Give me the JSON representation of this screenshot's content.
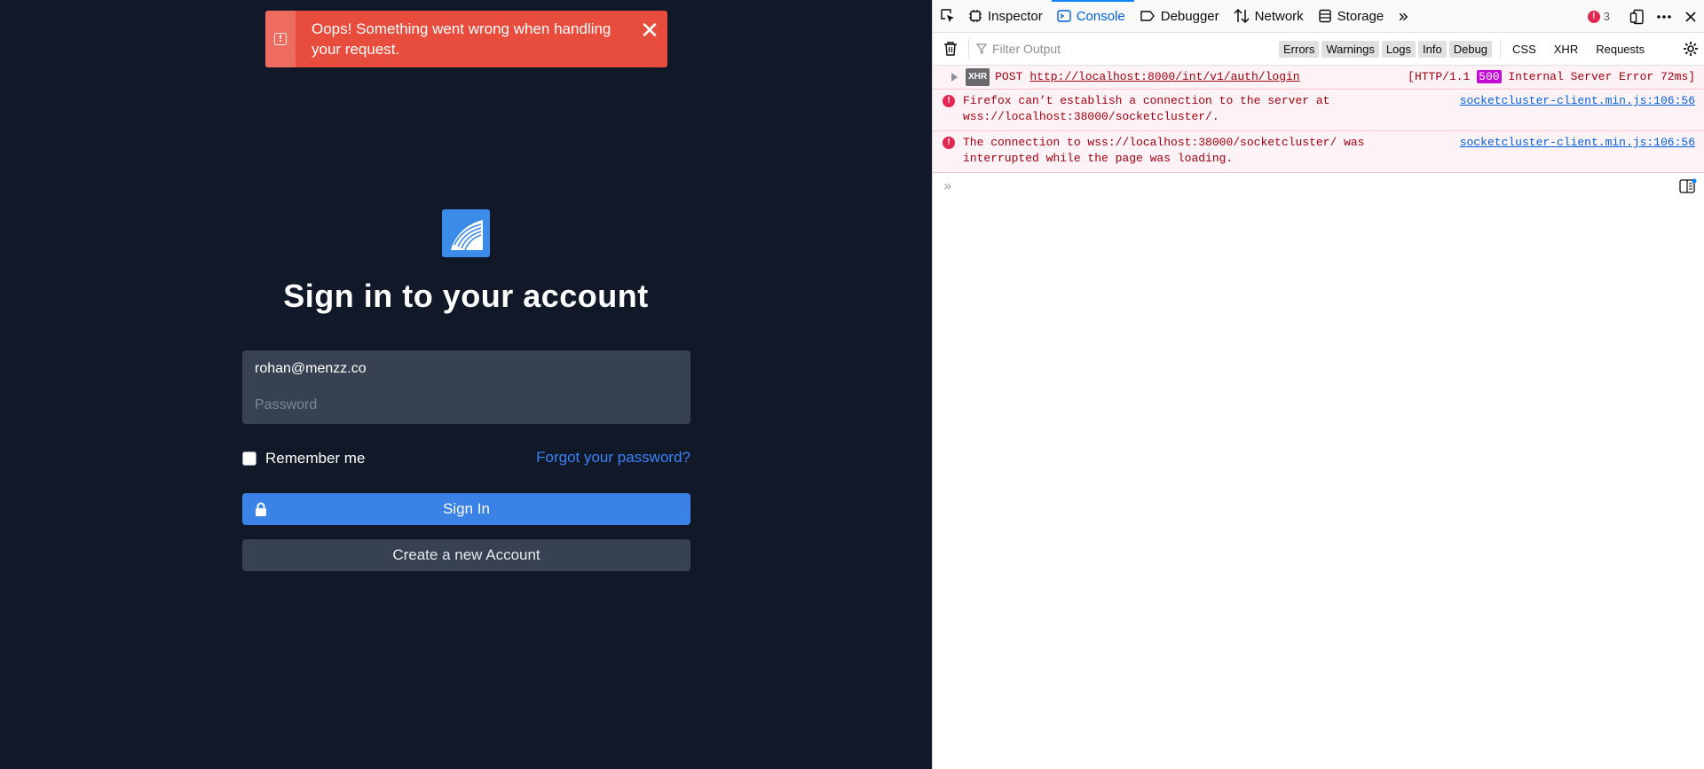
{
  "toast": {
    "message": "Oops! Something went wrong when handling your request.",
    "close_glyph": "✕",
    "icon_glyph": "!"
  },
  "login": {
    "title": "Sign in to your account",
    "email_value": "rohan@menzz.co",
    "password_placeholder": "Password",
    "remember_label": "Remember me",
    "forgot_label": "Forgot your password?",
    "signin_label": "Sign In",
    "create_label": "Create a new Account"
  },
  "devtools": {
    "tabs": [
      {
        "label": "Inspector",
        "icon": "inspector-icon"
      },
      {
        "label": "Console",
        "icon": "console-icon",
        "active": true
      },
      {
        "label": "Debugger",
        "icon": "debugger-icon"
      },
      {
        "label": "Network",
        "icon": "network-icon"
      },
      {
        "label": "Storage",
        "icon": "storage-icon"
      }
    ],
    "more_tabs_glyph": "»",
    "error_count": "3",
    "filter_placeholder": "Filter Output",
    "filter_buttons": [
      "Errors",
      "Warnings",
      "Logs",
      "Info",
      "Debug"
    ],
    "extra_filters": [
      "CSS",
      "XHR",
      "Requests"
    ],
    "xhr_message": {
      "badge": "XHR",
      "method": "POST",
      "url": "http://localhost:8000/int/v1/auth/login",
      "status_prefix": "[HTTP/1.1 ",
      "status_code": "500",
      "status_suffix": " Internal Server Error 72ms]"
    },
    "errors": [
      {
        "text": "Firefox can’t establish a connection to the server at wss://localhost:38000/socketcluster/.",
        "location": "socketcluster-client.min.js:106:56"
      },
      {
        "text": "The connection to wss://localhost:38000/socketcluster/ was interrupted while the page was loading.",
        "location": "socketcluster-client.min.js:106:56"
      }
    ],
    "prompt_glyph": "»"
  },
  "colors": {
    "background": "#111827",
    "toast": "#e74c3c",
    "primary": "#3b82e6",
    "link": "#3b82f6",
    "devtools_error": "#a4000f",
    "http_500_badge": "#c50ad8"
  }
}
